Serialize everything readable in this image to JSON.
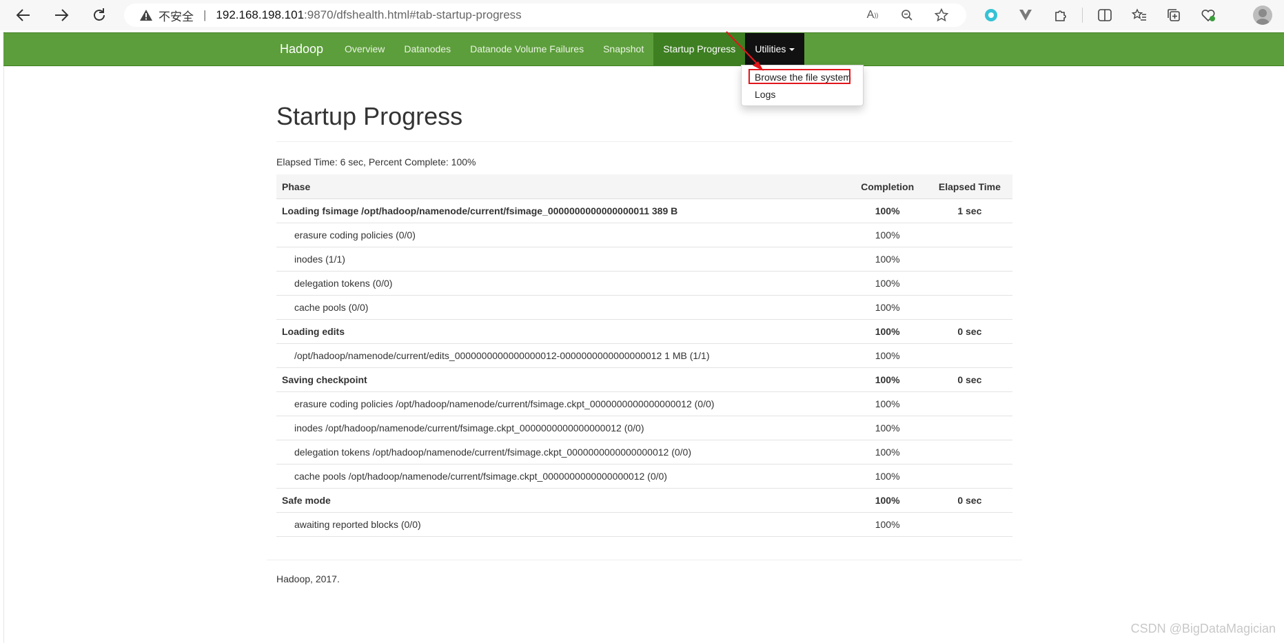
{
  "browser": {
    "security_label": "不安全",
    "url_host": "192.168.198.101",
    "url_rest": ":9870/dfshealth.html#tab-startup-progress"
  },
  "navbar": {
    "brand": "Hadoop",
    "items": [
      {
        "label": "Overview"
      },
      {
        "label": "Datanodes"
      },
      {
        "label": "Datanode Volume Failures"
      },
      {
        "label": "Snapshot"
      },
      {
        "label": "Startup Progress"
      },
      {
        "label": "Utilities"
      }
    ],
    "dropdown": [
      {
        "label": "Browse the file system"
      },
      {
        "label": "Logs"
      }
    ],
    "colors": {
      "navbar": "#5c9e3b",
      "active": "#3e7f22",
      "open": "#111111",
      "highlight": "#e0151b"
    }
  },
  "main": {
    "title": "Startup Progress",
    "elapsed": "Elapsed Time: 6 sec, Percent Complete: 100%",
    "table": {
      "headers": [
        "Phase",
        "Completion",
        "Elapsed Time"
      ],
      "rows": [
        {
          "label": "Loading fsimage /opt/hadoop/namenode/current/fsimage_0000000000000000011 389 B",
          "completion": "100%",
          "elapsed": "1 sec"
        },
        {
          "label": "erasure coding policies (0/0)",
          "completion": "100%",
          "elapsed": ""
        },
        {
          "label": "inodes (1/1)",
          "completion": "100%",
          "elapsed": ""
        },
        {
          "label": "delegation tokens (0/0)",
          "completion": "100%",
          "elapsed": ""
        },
        {
          "label": "cache pools (0/0)",
          "completion": "100%",
          "elapsed": ""
        },
        {
          "label": "Loading edits",
          "completion": "100%",
          "elapsed": "0 sec"
        },
        {
          "label": "/opt/hadoop/namenode/current/edits_0000000000000000012-0000000000000000012 1 MB (1/1)",
          "completion": "100%",
          "elapsed": ""
        },
        {
          "label": "Saving checkpoint",
          "completion": "100%",
          "elapsed": "0 sec"
        },
        {
          "label": "erasure coding policies /opt/hadoop/namenode/current/fsimage.ckpt_0000000000000000012 (0/0)",
          "completion": "100%",
          "elapsed": ""
        },
        {
          "label": "inodes /opt/hadoop/namenode/current/fsimage.ckpt_0000000000000000012 (0/0)",
          "completion": "100%",
          "elapsed": ""
        },
        {
          "label": "delegation tokens /opt/hadoop/namenode/current/fsimage.ckpt_0000000000000000012 (0/0)",
          "completion": "100%",
          "elapsed": ""
        },
        {
          "label": "cache pools /opt/hadoop/namenode/current/fsimage.ckpt_0000000000000000012 (0/0)",
          "completion": "100%",
          "elapsed": ""
        },
        {
          "label": "Safe mode",
          "completion": "100%",
          "elapsed": "0 sec"
        },
        {
          "label": "awaiting reported blocks (0/0)",
          "completion": "100%",
          "elapsed": ""
        }
      ]
    }
  },
  "footer": {
    "text": "Hadoop, 2017."
  },
  "watermark": "CSDN @BigDataMagician"
}
